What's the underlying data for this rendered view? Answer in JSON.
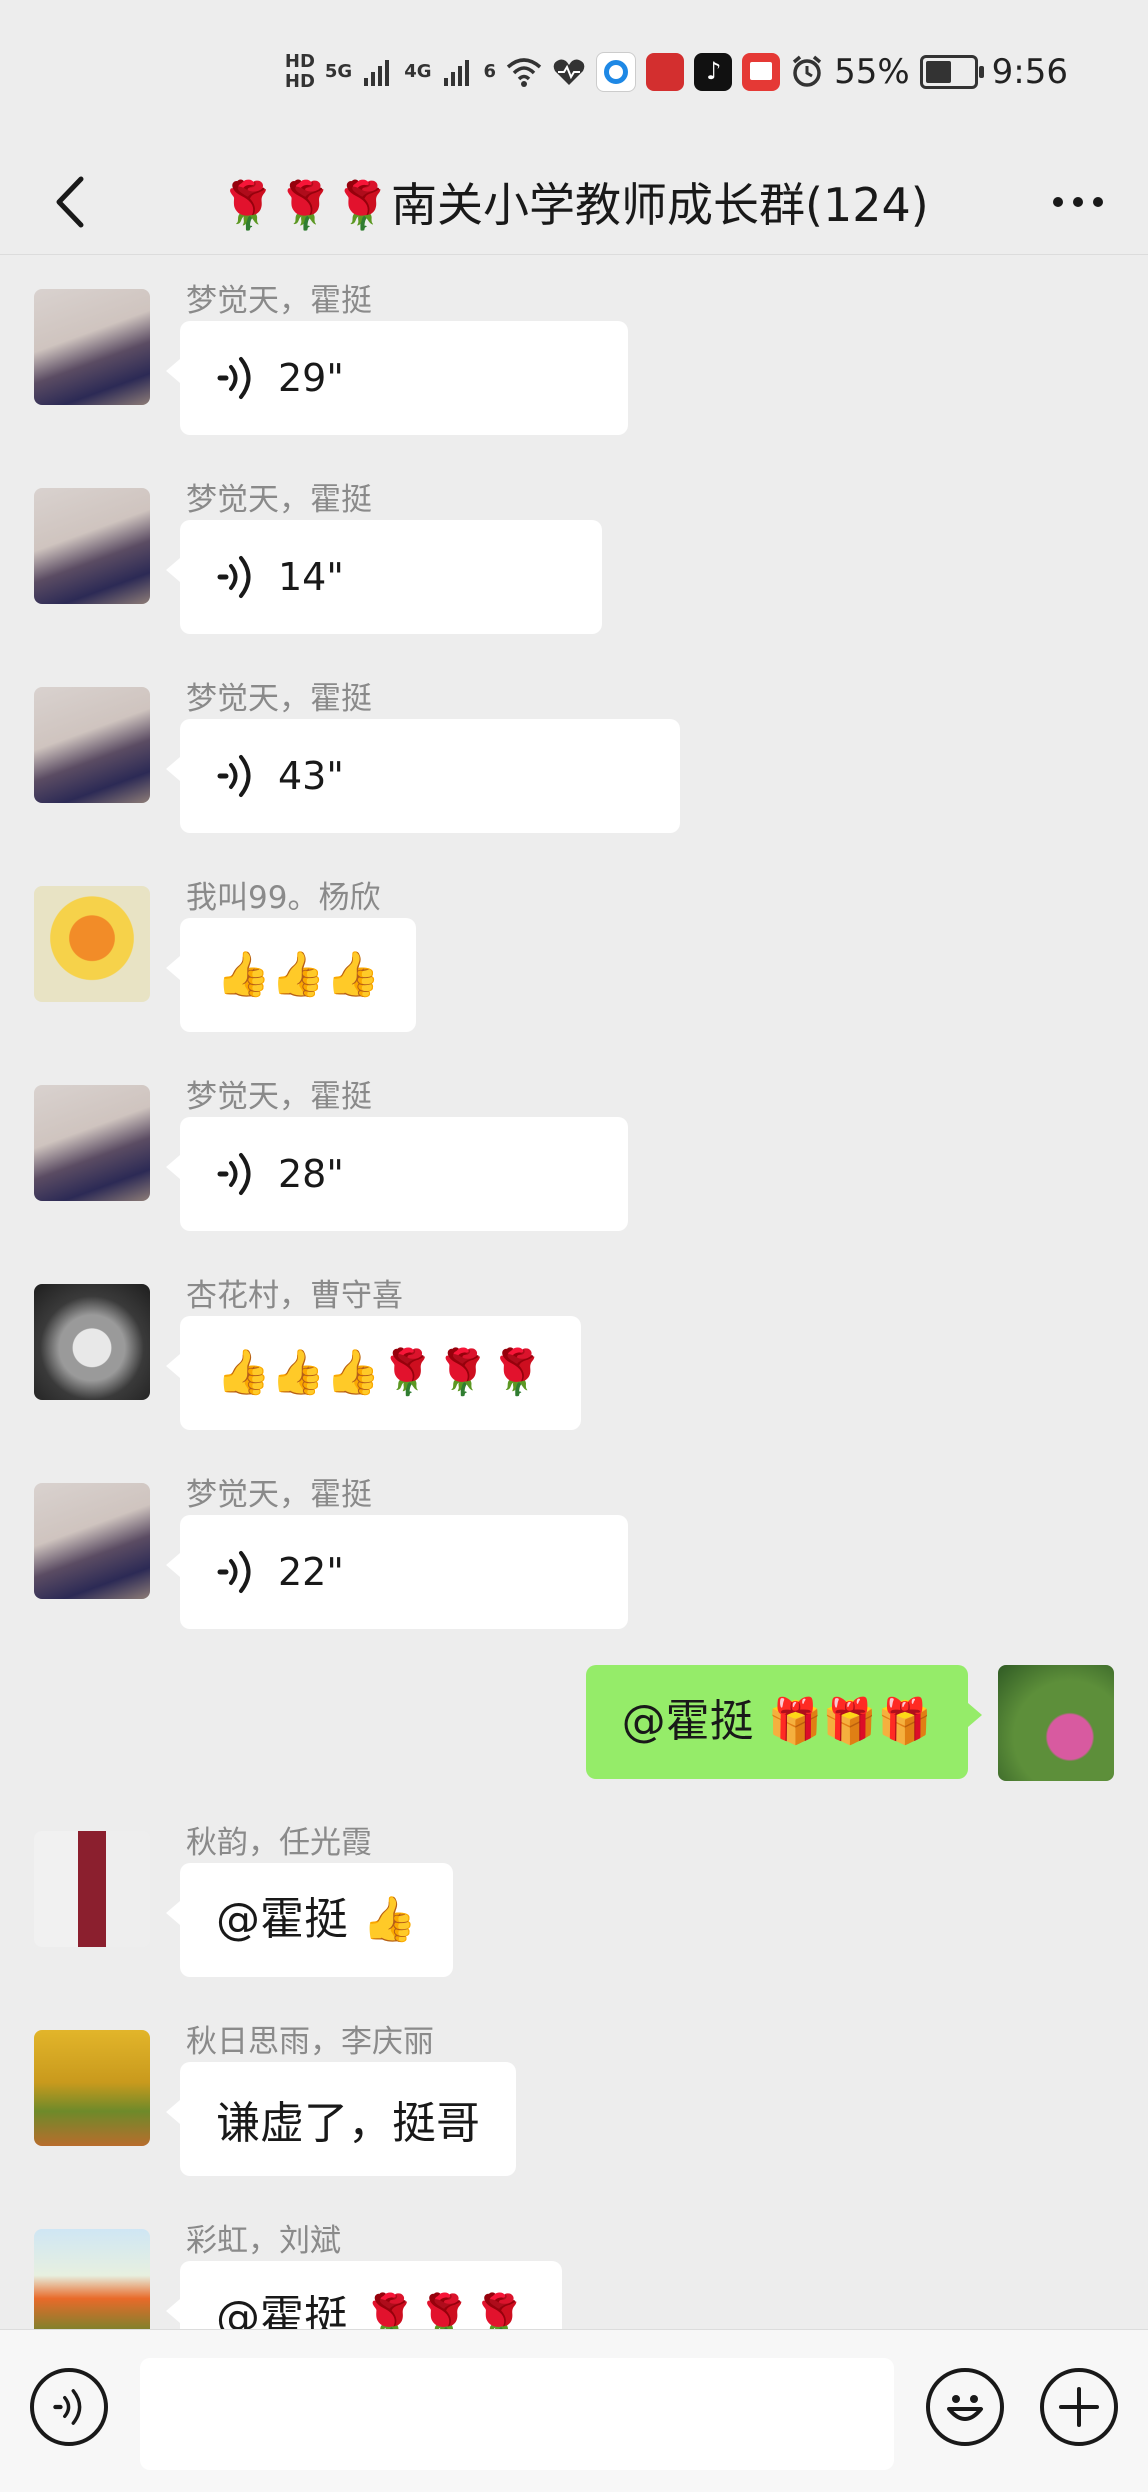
{
  "status_bar": {
    "hd1": "HD",
    "hd2": "HD",
    "net1": "5G",
    "net2": "4G",
    "net3": "6",
    "battery_percent": "55%",
    "battery_level": 0.55,
    "time": "9:56",
    "icons": [
      "signal-icon",
      "signal-icon",
      "wifi-icon",
      "health-icon",
      "browser-icon",
      "app-icon",
      "tiktok-icon",
      "book-icon",
      "alarm-icon",
      "battery-icon"
    ]
  },
  "header": {
    "title": "🌹🌹🌹南关小学教师成长群(124)",
    "back_icon": "chevron-left-icon",
    "more_icon": "more-icon"
  },
  "messages": [
    {
      "sender": "梦觉天，霍挺",
      "type": "voice",
      "duration": "29\""
    },
    {
      "sender": "梦觉天，霍挺",
      "type": "voice",
      "duration": "14\""
    },
    {
      "sender": "梦觉天，霍挺",
      "type": "voice",
      "duration": "43\""
    },
    {
      "sender": "我叫99。杨欣",
      "type": "text",
      "text": "👍👍👍"
    },
    {
      "sender": "梦觉天，霍挺",
      "type": "voice",
      "duration": "28\""
    },
    {
      "sender": "杏花村，曹守喜",
      "type": "text",
      "text": "👍👍👍🌹🌹🌹"
    },
    {
      "sender": "梦觉天，霍挺",
      "type": "voice",
      "duration": "22\""
    },
    {
      "mine": true,
      "type": "text",
      "text": "@霍挺 🎁🎁🎁"
    },
    {
      "sender": "秋韵，任光霞",
      "type": "text",
      "text": "@霍挺 👍"
    },
    {
      "sender": "秋日思雨，李庆丽",
      "type": "text",
      "text": "谦虚了，挺哥"
    },
    {
      "sender": "彩虹，刘斌",
      "type": "text",
      "text": "@霍挺 🌹🌹🌹"
    }
  ],
  "input_bar": {
    "voice_icon": "voice-input-icon",
    "emoji_icon": "emoji-icon",
    "plus_icon": "plus-icon",
    "input_value": ""
  },
  "colors": {
    "background": "#ededed",
    "bubble_other": "#ffffff",
    "bubble_mine": "#95ec69"
  }
}
